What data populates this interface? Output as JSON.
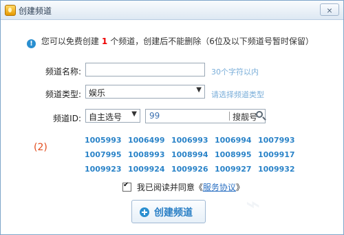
{
  "window": {
    "title": "创建频道",
    "close_label": "×"
  },
  "notice": {
    "before": "您可以免费创建",
    "count": "1",
    "after": "个频道，创建后不能删除（6位及以下频道号暂时保留）"
  },
  "form": {
    "name_label": "频道名称:",
    "name_value": "",
    "name_hint": "30个字符以内",
    "type_label": "频道类型:",
    "type_value": "娱乐",
    "type_hint": "请选择频道类型",
    "id_label": "频道ID:",
    "id_mode": "自主选号",
    "id_search_value": "99",
    "id_search_button": "搜靓号"
  },
  "marker": "(2)",
  "ids": [
    "1005993",
    "1006499",
    "1006993",
    "1006994",
    "1007993",
    "1007995",
    "1008993",
    "1008994",
    "1008995",
    "1009917",
    "1009923",
    "1009924",
    "1009926",
    "1009927",
    "1009932"
  ],
  "agreement": {
    "text": "我已阅读并同意《",
    "link": "服务协议",
    "end": "》"
  },
  "create_button": "创建频道",
  "colors": {
    "accent": "#2a83c8",
    "red": "#e00000"
  }
}
